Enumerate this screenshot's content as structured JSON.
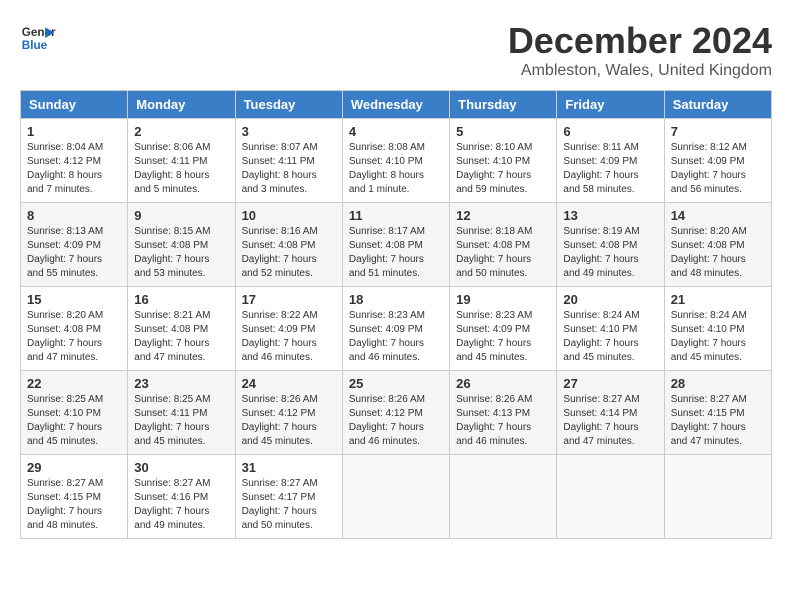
{
  "header": {
    "logo_line1": "General",
    "logo_line2": "Blue",
    "month_title": "December 2024",
    "location": "Ambleston, Wales, United Kingdom"
  },
  "days_of_week": [
    "Sunday",
    "Monday",
    "Tuesday",
    "Wednesday",
    "Thursday",
    "Friday",
    "Saturday"
  ],
  "weeks": [
    [
      {
        "day": "1",
        "info": "Sunrise: 8:04 AM\nSunset: 4:12 PM\nDaylight: 8 hours and 7 minutes."
      },
      {
        "day": "2",
        "info": "Sunrise: 8:06 AM\nSunset: 4:11 PM\nDaylight: 8 hours and 5 minutes."
      },
      {
        "day": "3",
        "info": "Sunrise: 8:07 AM\nSunset: 4:11 PM\nDaylight: 8 hours and 3 minutes."
      },
      {
        "day": "4",
        "info": "Sunrise: 8:08 AM\nSunset: 4:10 PM\nDaylight: 8 hours and 1 minute."
      },
      {
        "day": "5",
        "info": "Sunrise: 8:10 AM\nSunset: 4:10 PM\nDaylight: 7 hours and 59 minutes."
      },
      {
        "day": "6",
        "info": "Sunrise: 8:11 AM\nSunset: 4:09 PM\nDaylight: 7 hours and 58 minutes."
      },
      {
        "day": "7",
        "info": "Sunrise: 8:12 AM\nSunset: 4:09 PM\nDaylight: 7 hours and 56 minutes."
      }
    ],
    [
      {
        "day": "8",
        "info": "Sunrise: 8:13 AM\nSunset: 4:09 PM\nDaylight: 7 hours and 55 minutes."
      },
      {
        "day": "9",
        "info": "Sunrise: 8:15 AM\nSunset: 4:08 PM\nDaylight: 7 hours and 53 minutes."
      },
      {
        "day": "10",
        "info": "Sunrise: 8:16 AM\nSunset: 4:08 PM\nDaylight: 7 hours and 52 minutes."
      },
      {
        "day": "11",
        "info": "Sunrise: 8:17 AM\nSunset: 4:08 PM\nDaylight: 7 hours and 51 minutes."
      },
      {
        "day": "12",
        "info": "Sunrise: 8:18 AM\nSunset: 4:08 PM\nDaylight: 7 hours and 50 minutes."
      },
      {
        "day": "13",
        "info": "Sunrise: 8:19 AM\nSunset: 4:08 PM\nDaylight: 7 hours and 49 minutes."
      },
      {
        "day": "14",
        "info": "Sunrise: 8:20 AM\nSunset: 4:08 PM\nDaylight: 7 hours and 48 minutes."
      }
    ],
    [
      {
        "day": "15",
        "info": "Sunrise: 8:20 AM\nSunset: 4:08 PM\nDaylight: 7 hours and 47 minutes."
      },
      {
        "day": "16",
        "info": "Sunrise: 8:21 AM\nSunset: 4:08 PM\nDaylight: 7 hours and 47 minutes."
      },
      {
        "day": "17",
        "info": "Sunrise: 8:22 AM\nSunset: 4:09 PM\nDaylight: 7 hours and 46 minutes."
      },
      {
        "day": "18",
        "info": "Sunrise: 8:23 AM\nSunset: 4:09 PM\nDaylight: 7 hours and 46 minutes."
      },
      {
        "day": "19",
        "info": "Sunrise: 8:23 AM\nSunset: 4:09 PM\nDaylight: 7 hours and 45 minutes."
      },
      {
        "day": "20",
        "info": "Sunrise: 8:24 AM\nSunset: 4:10 PM\nDaylight: 7 hours and 45 minutes."
      },
      {
        "day": "21",
        "info": "Sunrise: 8:24 AM\nSunset: 4:10 PM\nDaylight: 7 hours and 45 minutes."
      }
    ],
    [
      {
        "day": "22",
        "info": "Sunrise: 8:25 AM\nSunset: 4:10 PM\nDaylight: 7 hours and 45 minutes."
      },
      {
        "day": "23",
        "info": "Sunrise: 8:25 AM\nSunset: 4:11 PM\nDaylight: 7 hours and 45 minutes."
      },
      {
        "day": "24",
        "info": "Sunrise: 8:26 AM\nSunset: 4:12 PM\nDaylight: 7 hours and 45 minutes."
      },
      {
        "day": "25",
        "info": "Sunrise: 8:26 AM\nSunset: 4:12 PM\nDaylight: 7 hours and 46 minutes."
      },
      {
        "day": "26",
        "info": "Sunrise: 8:26 AM\nSunset: 4:13 PM\nDaylight: 7 hours and 46 minutes."
      },
      {
        "day": "27",
        "info": "Sunrise: 8:27 AM\nSunset: 4:14 PM\nDaylight: 7 hours and 47 minutes."
      },
      {
        "day": "28",
        "info": "Sunrise: 8:27 AM\nSunset: 4:15 PM\nDaylight: 7 hours and 47 minutes."
      }
    ],
    [
      {
        "day": "29",
        "info": "Sunrise: 8:27 AM\nSunset: 4:15 PM\nDaylight: 7 hours and 48 minutes."
      },
      {
        "day": "30",
        "info": "Sunrise: 8:27 AM\nSunset: 4:16 PM\nDaylight: 7 hours and 49 minutes."
      },
      {
        "day": "31",
        "info": "Sunrise: 8:27 AM\nSunset: 4:17 PM\nDaylight: 7 hours and 50 minutes."
      },
      {
        "day": "",
        "info": ""
      },
      {
        "day": "",
        "info": ""
      },
      {
        "day": "",
        "info": ""
      },
      {
        "day": "",
        "info": ""
      }
    ]
  ]
}
